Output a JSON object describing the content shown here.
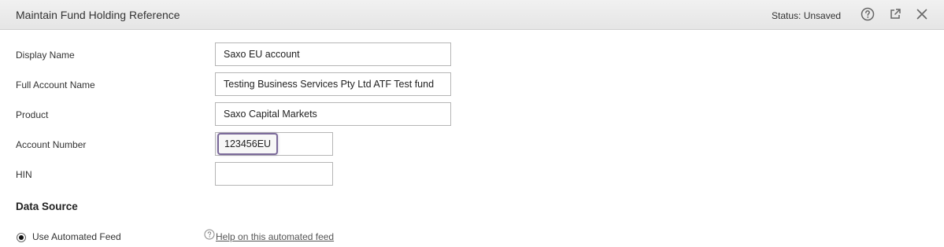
{
  "header": {
    "title": "Maintain Fund Holding Reference",
    "status": "Status: Unsaved",
    "icons": [
      "help-icon",
      "open-external-icon",
      "close-icon"
    ]
  },
  "form": {
    "display_name": {
      "label": "Display Name",
      "value": "Saxo EU account"
    },
    "full_account_name": {
      "label": "Full Account Name",
      "value": "Testing Business Services Pty Ltd ATF Test fund"
    },
    "product": {
      "label": "Product",
      "value": "Saxo Capital Markets"
    },
    "account_number": {
      "label": "Account Number",
      "value": "123456EU"
    },
    "hin": {
      "label": "HIN",
      "value": ""
    }
  },
  "data_source": {
    "heading": "Data Source",
    "option_label": "Use Automated Feed",
    "selected": true,
    "help_link": "Help on this automated feed"
  },
  "colors": {
    "focus_border": "#7b6a9a",
    "header_bg": "#e9e9e9"
  }
}
